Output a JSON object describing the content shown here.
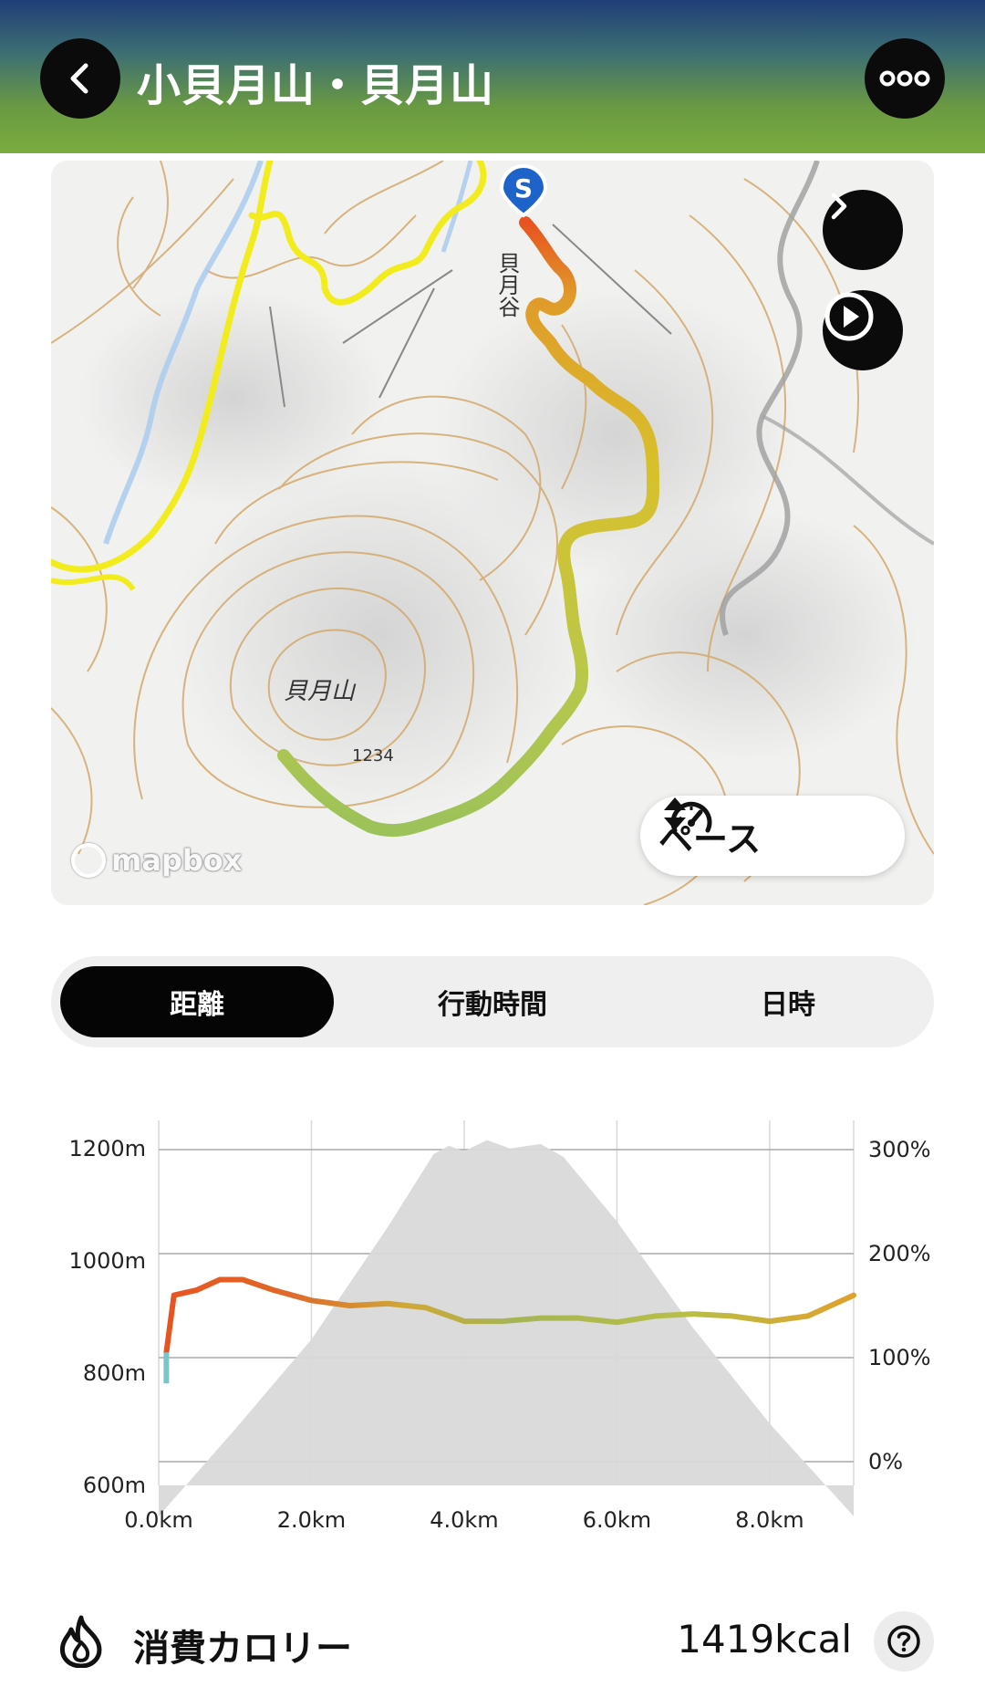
{
  "header": {
    "title": "小貝月山・貝月山",
    "back_icon": "chevron-left-icon",
    "more_icon": "more-horizontal-icon"
  },
  "map": {
    "labels": [
      {
        "text": "貝月谷"
      },
      {
        "text": "貝月山"
      },
      {
        "text": "1234"
      }
    ],
    "start_marker": "S",
    "attribution": "mapbox",
    "pace_selector": {
      "label": "ペース",
      "icon": "speedometer-icon"
    },
    "next_icon": "chevron-right-icon",
    "play_icon": "play-circle-icon"
  },
  "tabs": [
    {
      "label": "距離",
      "active": true
    },
    {
      "label": "行動時間",
      "active": false
    },
    {
      "label": "日時",
      "active": false
    }
  ],
  "chart_data": {
    "type": "area",
    "x_tick_labels": [
      "0.0km",
      "2.0km",
      "4.0km",
      "6.0km",
      "8.0km"
    ],
    "y_left_tick_labels": [
      "1200m",
      "1000m",
      "800m",
      "600m"
    ],
    "y_right_tick_labels": [
      "300%",
      "200%",
      "100%",
      "0%"
    ],
    "xlim": [
      0,
      9.1
    ],
    "ylim_elevation": [
      600,
      1250
    ],
    "ylim_pace_percent": [
      0,
      300
    ],
    "series": [
      {
        "x": [
          0,
          1,
          2,
          3,
          3.6,
          3.8,
          4.0,
          4.3,
          4.6,
          5.0,
          5.3,
          6.0,
          7.0,
          8.0,
          9.1
        ],
        "values": [
          545,
          700,
          860,
          1060,
          1190,
          1205,
          1195,
          1215,
          1200,
          1208,
          1185,
          1070,
          880,
          710,
          545
        ]
      },
      {
        "x": [
          0.1,
          0.2,
          0.5,
          0.8,
          1.1,
          1.5,
          2.0,
          2.5,
          3.0,
          3.5,
          4.0,
          4.5,
          5.0,
          5.5,
          6.0,
          6.5,
          7.0,
          7.5,
          8.0,
          8.5,
          9.1
        ],
        "values": [
          105,
          160,
          165,
          175,
          175,
          165,
          155,
          150,
          152,
          148,
          135,
          135,
          138,
          138,
          134,
          140,
          142,
          140,
          135,
          140,
          160
        ]
      }
    ],
    "grid": true
  },
  "calories": {
    "label": "消費カロリー",
    "value": "1419kcal",
    "icon": "flame-icon",
    "help_icon": "help-circle-icon"
  },
  "colors": {
    "route_start": "#e8531f",
    "route_mid": "#d9c02b",
    "route_end": "#9cc25a",
    "profile_fill": "#dcdcdc",
    "accent_dark": "#0b0b0b"
  }
}
